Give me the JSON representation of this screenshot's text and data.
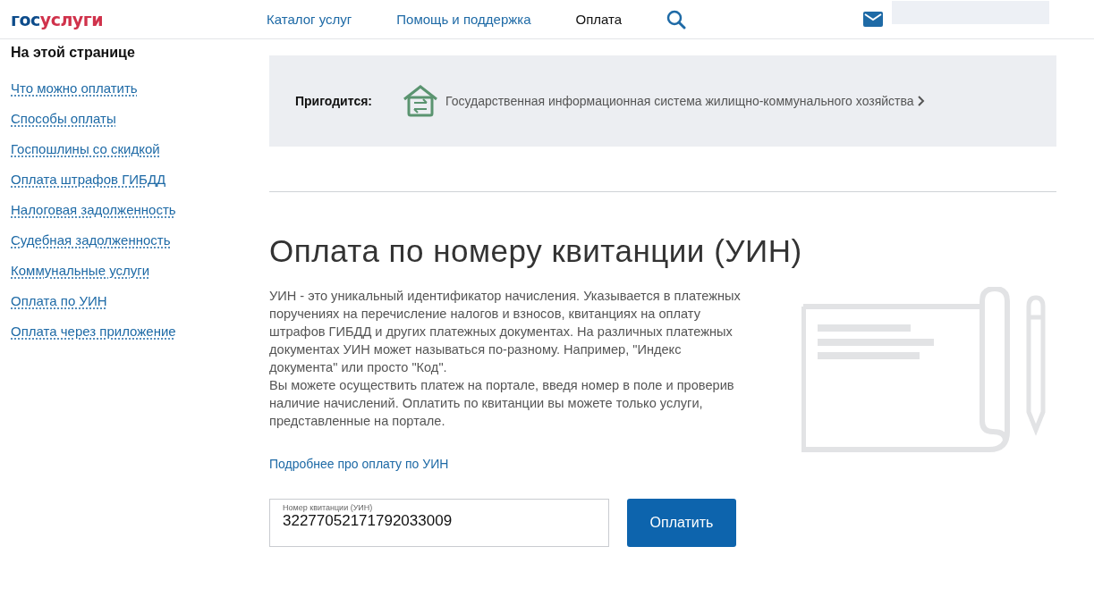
{
  "header": {
    "logo": {
      "lead": "гос",
      "rest": "услуги"
    },
    "nav": [
      {
        "label": "Каталог услуг",
        "selected": false
      },
      {
        "label": "Помощь и поддержка",
        "selected": false
      },
      {
        "label": "Оплата",
        "selected": true
      }
    ]
  },
  "sidebar": {
    "title": "На этой странице",
    "links": [
      "Что можно оплатить",
      "Способы оплаты",
      "Госпошлины со скидкой",
      "Оплата штрафов ГИБДД",
      "Налоговая задолженность",
      "Судебная задолженность",
      "Коммунальные услуги",
      "Оплата по УИН",
      "Оплата через приложение"
    ]
  },
  "banner": {
    "label": "Пригодится:",
    "link": "Государственная информационная система жилищно-коммунального хозяйства"
  },
  "heading": "Оплата по номеру квитанции (УИН)",
  "paragraphs": [
    "УИН - это уникальный идентификатор начисления. Указывается в платежных поручениях на перечисление налогов и взносов, квитанциях на оплату штрафов ГИБДД и других платежных документах. На различных платежных документах УИН может называться по-разному. Например, \"Индекс документа\" или просто \"Код\".",
    "Вы можете осуществить платеж на портале, введя номер в поле и проверив наличие начислений. Оплатить по квитанции вы можете только услуги, представленные на портале."
  ],
  "more_link": "Подробнее про оплату по УИН",
  "form": {
    "field_label": "Номер квитанции (УИН)",
    "value": "32277052171792033009",
    "button": "Оплатить"
  }
}
